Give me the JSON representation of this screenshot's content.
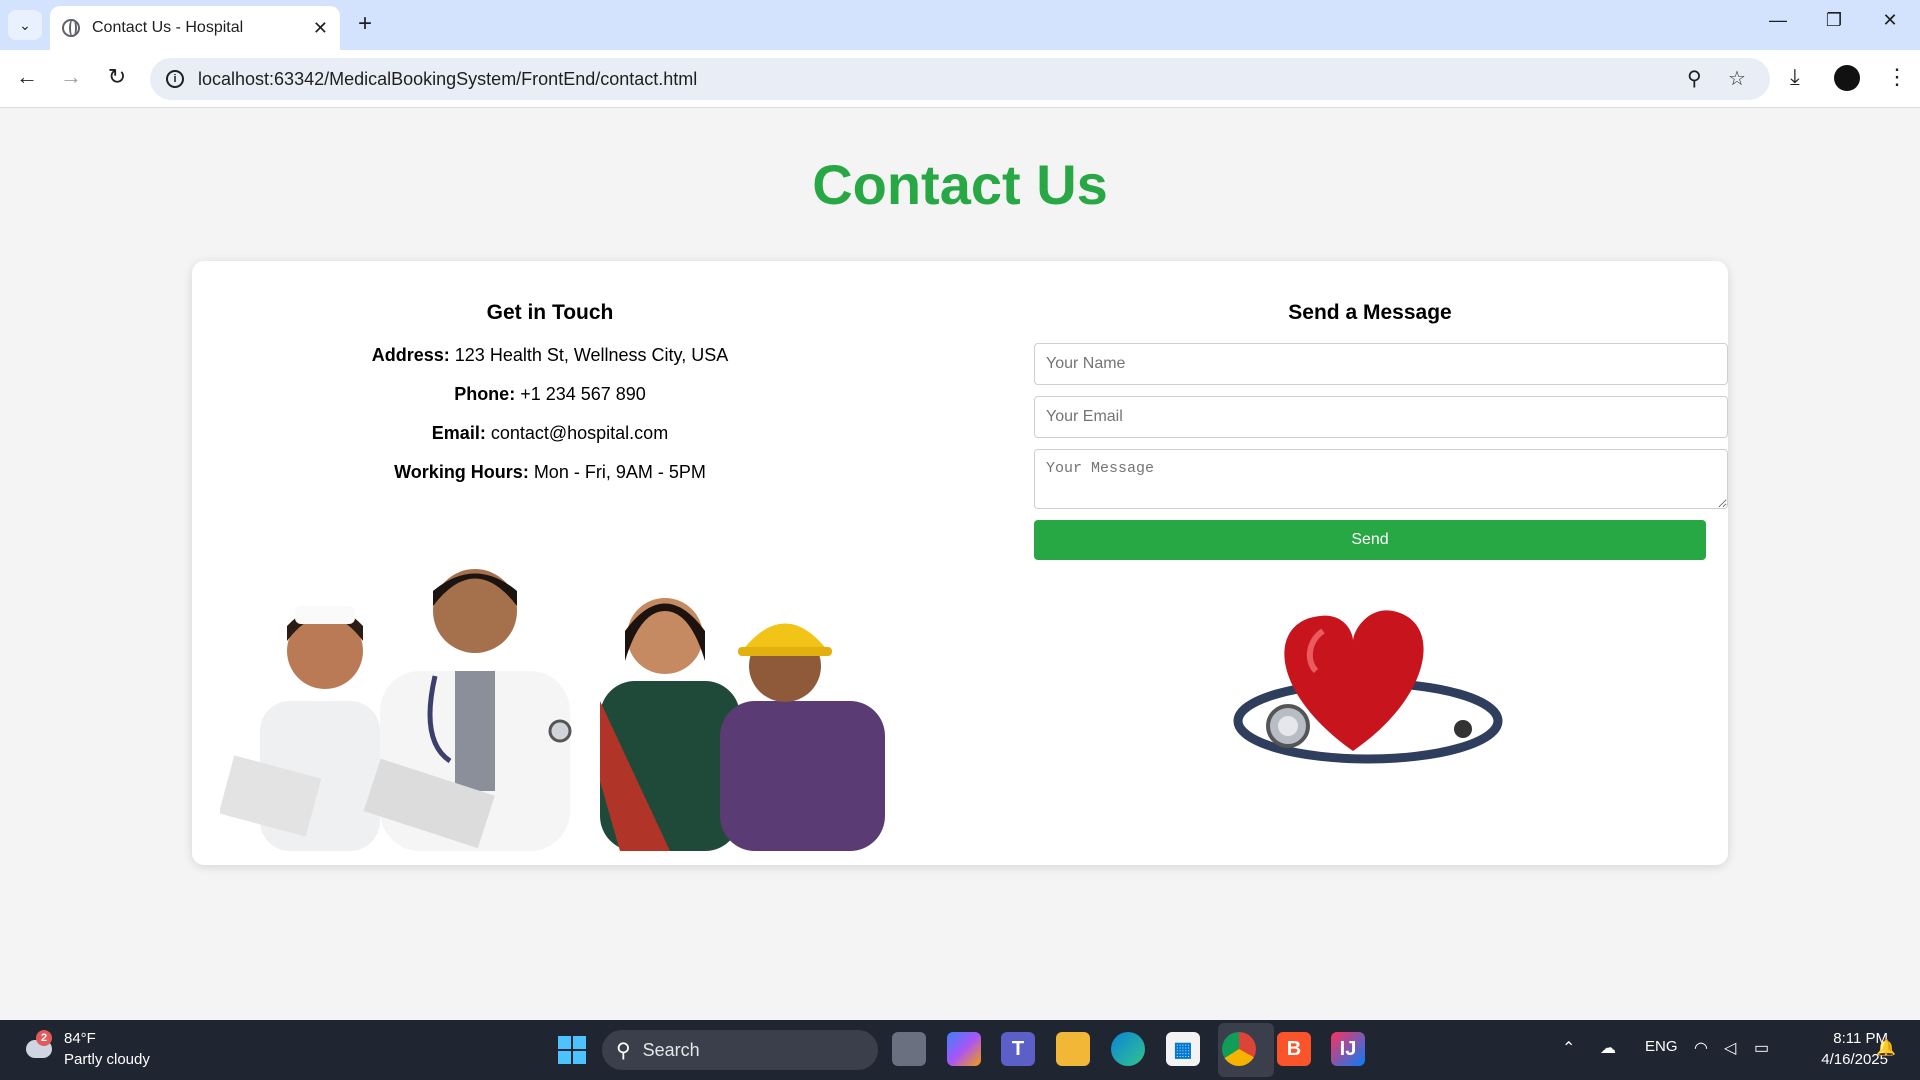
{
  "browser": {
    "tab_title": "Contact Us - Hospital",
    "tab_close": "✕",
    "new_tab": "+",
    "url": "localhost:63342/MedicalBookingSystem/FrontEnd/contact.html",
    "icons": [
      "tab-list-icon",
      "back-icon",
      "forward-icon",
      "reload-icon",
      "site-info-icon",
      "zoom-icon",
      "bookmark-star-icon",
      "download-icon",
      "profile-avatar",
      "menu-kebab-icon",
      "minimize-icon",
      "restore-icon",
      "close-window-icon"
    ]
  },
  "page": {
    "heading": "Contact Us",
    "left": {
      "title": "Get in Touch",
      "address_label": "Address:",
      "address_value": " 123 Health St, Wellness City, USA",
      "phone_label": "Phone:",
      "phone_value": " +1 234 567 890",
      "email_label": "Email:",
      "email_value": " contact@hospital.com",
      "hours_label": "Working Hours:",
      "hours_value": " Mon - Fri, 9AM - 5PM"
    },
    "right": {
      "title": "Send a Message",
      "name_placeholder": "Your Name",
      "email_placeholder": "Your Email",
      "message_placeholder": "Your Message",
      "send_label": "Send"
    }
  },
  "taskbar": {
    "weather_badge": "2",
    "temperature": "84°F",
    "condition": "Partly cloudy",
    "search_label": "Search",
    "language": "ENG",
    "time": "8:11 PM",
    "date": "4/16/2025"
  },
  "colors": {
    "accent_green": "#28a745",
    "tabbar": "#d3e3fd",
    "taskbar": "#202532"
  }
}
